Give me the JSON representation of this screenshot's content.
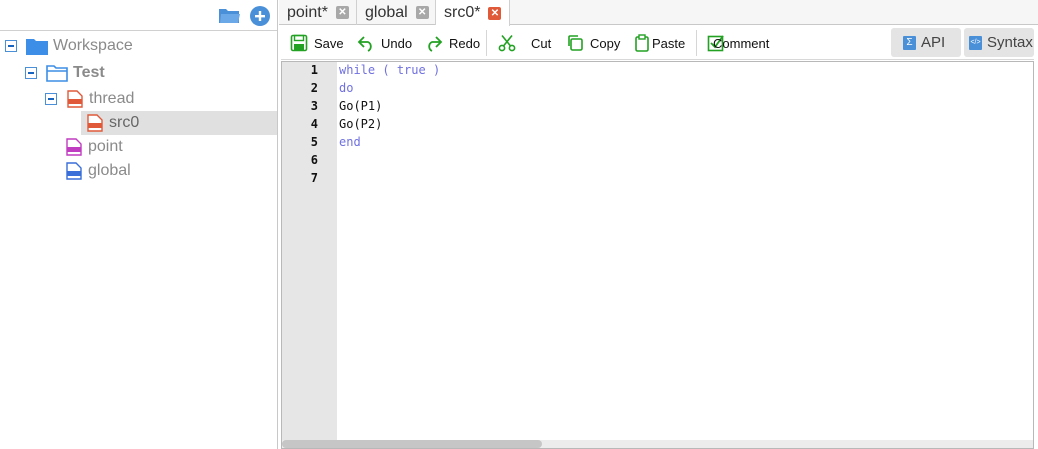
{
  "tree": {
    "workspace": "Workspace",
    "project": "Test",
    "thread": "thread",
    "src": "src0",
    "point": "point",
    "global": "global"
  },
  "tabs": [
    {
      "label": "point*"
    },
    {
      "label": "global"
    },
    {
      "label": "src0*"
    }
  ],
  "toolbar": {
    "save": "Save",
    "undo": "Undo",
    "redo": "Redo",
    "cut": "Cut",
    "copy": "Copy",
    "paste": "Paste",
    "comment": "Comment",
    "api": "API",
    "syntax": "Syntax"
  },
  "editor": {
    "line_numbers": [
      "1",
      "2",
      "3",
      "4",
      "5",
      "6",
      "7"
    ],
    "lines": {
      "l1_kw1": "while",
      "l1_p1": " ( ",
      "l1_kw2": "true",
      "l1_p2": " )",
      "l2": "do",
      "l3": "Go(P1)",
      "l4": "Go(P2)",
      "l5": "end"
    }
  },
  "colors": {
    "accent": "#4a90d9",
    "keyword": "#7070e0",
    "active_tab_close": "#e05a3a",
    "toolbar_icon": "#22a122"
  }
}
